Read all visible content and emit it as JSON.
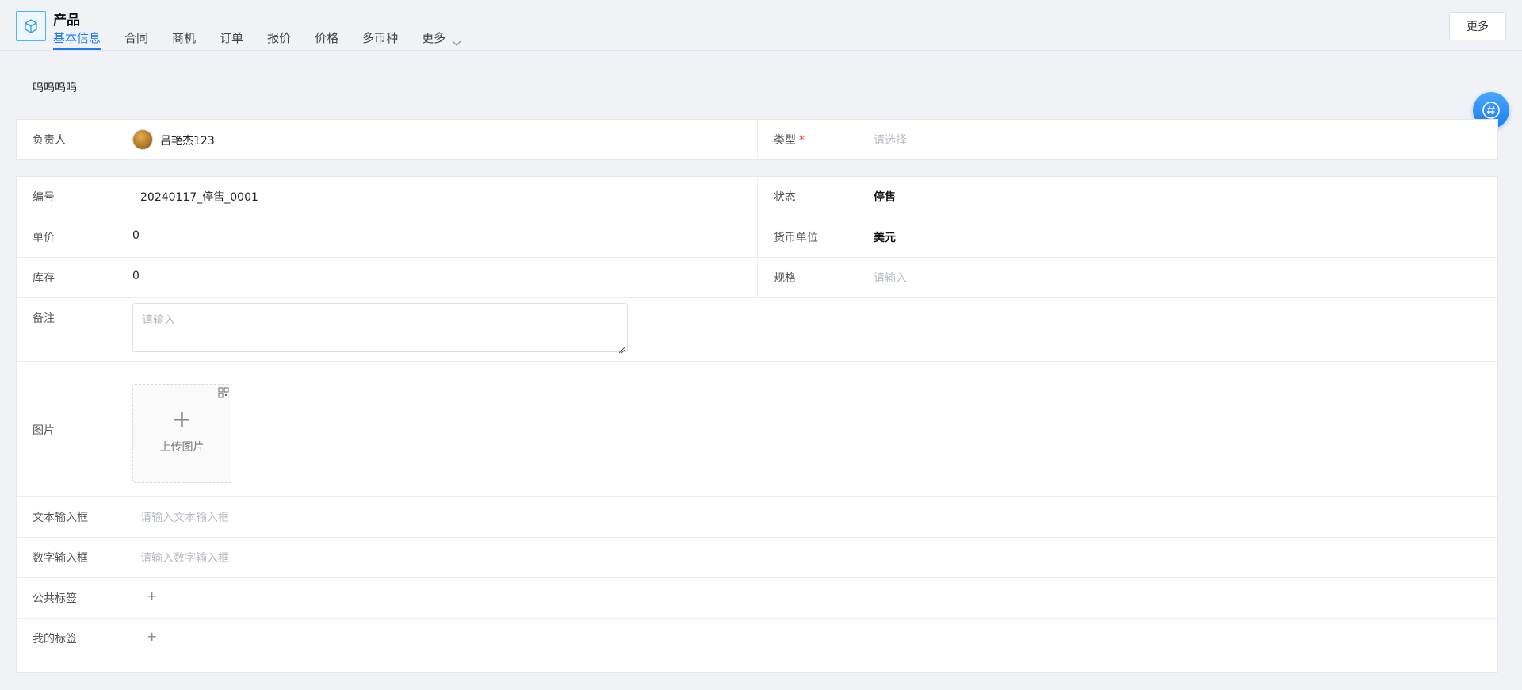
{
  "header": {
    "title": "产品",
    "tabs": [
      {
        "label": "基本信息",
        "active": true
      },
      {
        "label": "合同"
      },
      {
        "label": "商机"
      },
      {
        "label": "订单"
      },
      {
        "label": "报价"
      },
      {
        "label": "价格"
      },
      {
        "label": "多币种"
      },
      {
        "label": "更多"
      }
    ],
    "more_button": "更多"
  },
  "subtitle": "呜呜呜呜",
  "owner_card": {
    "owner_label": "负责人",
    "owner_name": "吕艳杰123",
    "type_label": "类型",
    "type_required": "*",
    "type_placeholder": "请选择"
  },
  "detail": {
    "number_label": "编号",
    "number_value": "20240117_停售_0001",
    "status_label": "状态",
    "status_value": "停售",
    "unit_price_label": "单价",
    "unit_price_value": "0",
    "currency_label": "货币单位",
    "currency_value": "美元",
    "stock_label": "库存",
    "stock_value": "0",
    "spec_label": "规格",
    "spec_placeholder": "请输入",
    "remark_label": "备注",
    "remark_placeholder": "请输入",
    "image_label": "图片",
    "upload_plus": "+",
    "upload_text": "上传图片",
    "text_input_label": "文本输入框",
    "text_input_placeholder": "请输入文本输入框",
    "number_input_label": "数字输入框",
    "number_input_placeholder": "请输入数字输入框",
    "public_tags_label": "公共标签",
    "public_tags_add": "+",
    "my_tags_label": "我的标签",
    "my_tags_add": "+"
  },
  "colors": {
    "accent": "#1d7cf2",
    "required": "#f04848",
    "placeholder": "#b8bcc4"
  },
  "icons": {
    "app": "cube-icon",
    "tab_more": "chevron-down-icon",
    "float": "hash-chat-icon",
    "upload_corner": "qr-code-icon",
    "resize": "resize-grip-icon"
  }
}
